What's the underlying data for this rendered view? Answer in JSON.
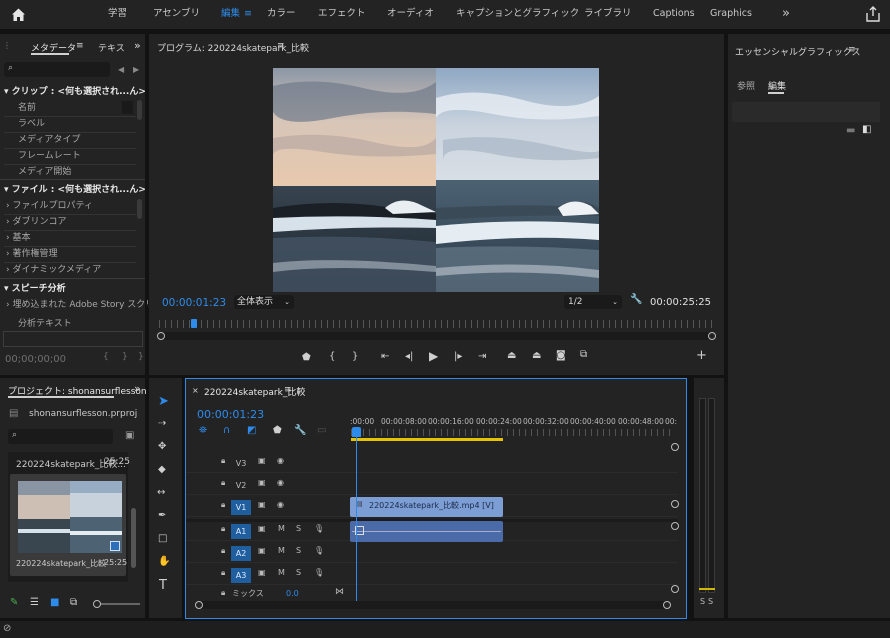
{
  "topbar": {
    "tabs": [
      "学習",
      "アセンブリ",
      "編集",
      "カラー",
      "エフェクト",
      "オーディオ",
      "キャプションとグラフィック",
      "ライブラリ",
      "Captions",
      "Graphics"
    ],
    "active_tab": "編集",
    "more": "»"
  },
  "left_panel": {
    "tab_metadata": "メタデータ",
    "tab_text": "テキス",
    "search_placeholder": "",
    "clip_section": "クリップ : <何も選択され...ん>",
    "clip_rows": [
      "名前",
      "ラベル",
      "メディアタイプ",
      "フレームレート",
      "メディア開始"
    ],
    "file_section": "ファイル : <何も選択され...ん>",
    "file_rows": [
      "ファイルプロパティ",
      "ダブリンコア",
      "基本",
      "著作権管理",
      "ダイナミックメディア"
    ],
    "speech_section": "スピーチ分析",
    "speech_row": "埋め込まれた Adobe Story スクリプト",
    "analysis_text": "分析テキスト",
    "timecode": "00;00;00;00",
    "brackets": [
      "{",
      "}",
      "}"
    ]
  },
  "program": {
    "title": "プログラム: 220224skatepark_比較",
    "menu": "≡",
    "timecode": "00:00:01:23",
    "zoom": "全体表示",
    "resolution": "1/2",
    "duration": "00:00:25:25"
  },
  "essential": {
    "title": "エッセンシャルグラフィックス",
    "tab_browse": "参照",
    "tab_edit": "編集"
  },
  "project": {
    "title": "プロジェクト: shonansurflesson",
    "file": "shonansurflesson.prproj",
    "list_item": "220224skatepark_比較...",
    "list_item_dur": "25:25",
    "thumb_name": "220224skatepark_比較",
    "thumb_dur": "25:25"
  },
  "timeline": {
    "title": "220224skatepark_比較",
    "timecode": "00:00:01:23",
    "ruler": [
      ":00:00",
      "00:00:08:00",
      "00:00:16:00",
      "00:00:24:00",
      "00:00:32:00",
      "00:00:40:00",
      "00:00:48:00",
      "00:"
    ],
    "video_tracks": [
      "V3",
      "V2",
      "V1"
    ],
    "audio_tracks": [
      "A1",
      "A2",
      "A3"
    ],
    "mix_label": "ミックス",
    "mix_value": "0.0",
    "clip_label": "220224skatepark_比較.mp4 [V]"
  },
  "meter": {
    "labels": [
      "S",
      "S"
    ]
  },
  "colors": {
    "accent": "#2d8ceb",
    "clip": "#7d9ed4",
    "clip_dark": "#4a6ba8",
    "track_on": "#1f5fa0"
  }
}
